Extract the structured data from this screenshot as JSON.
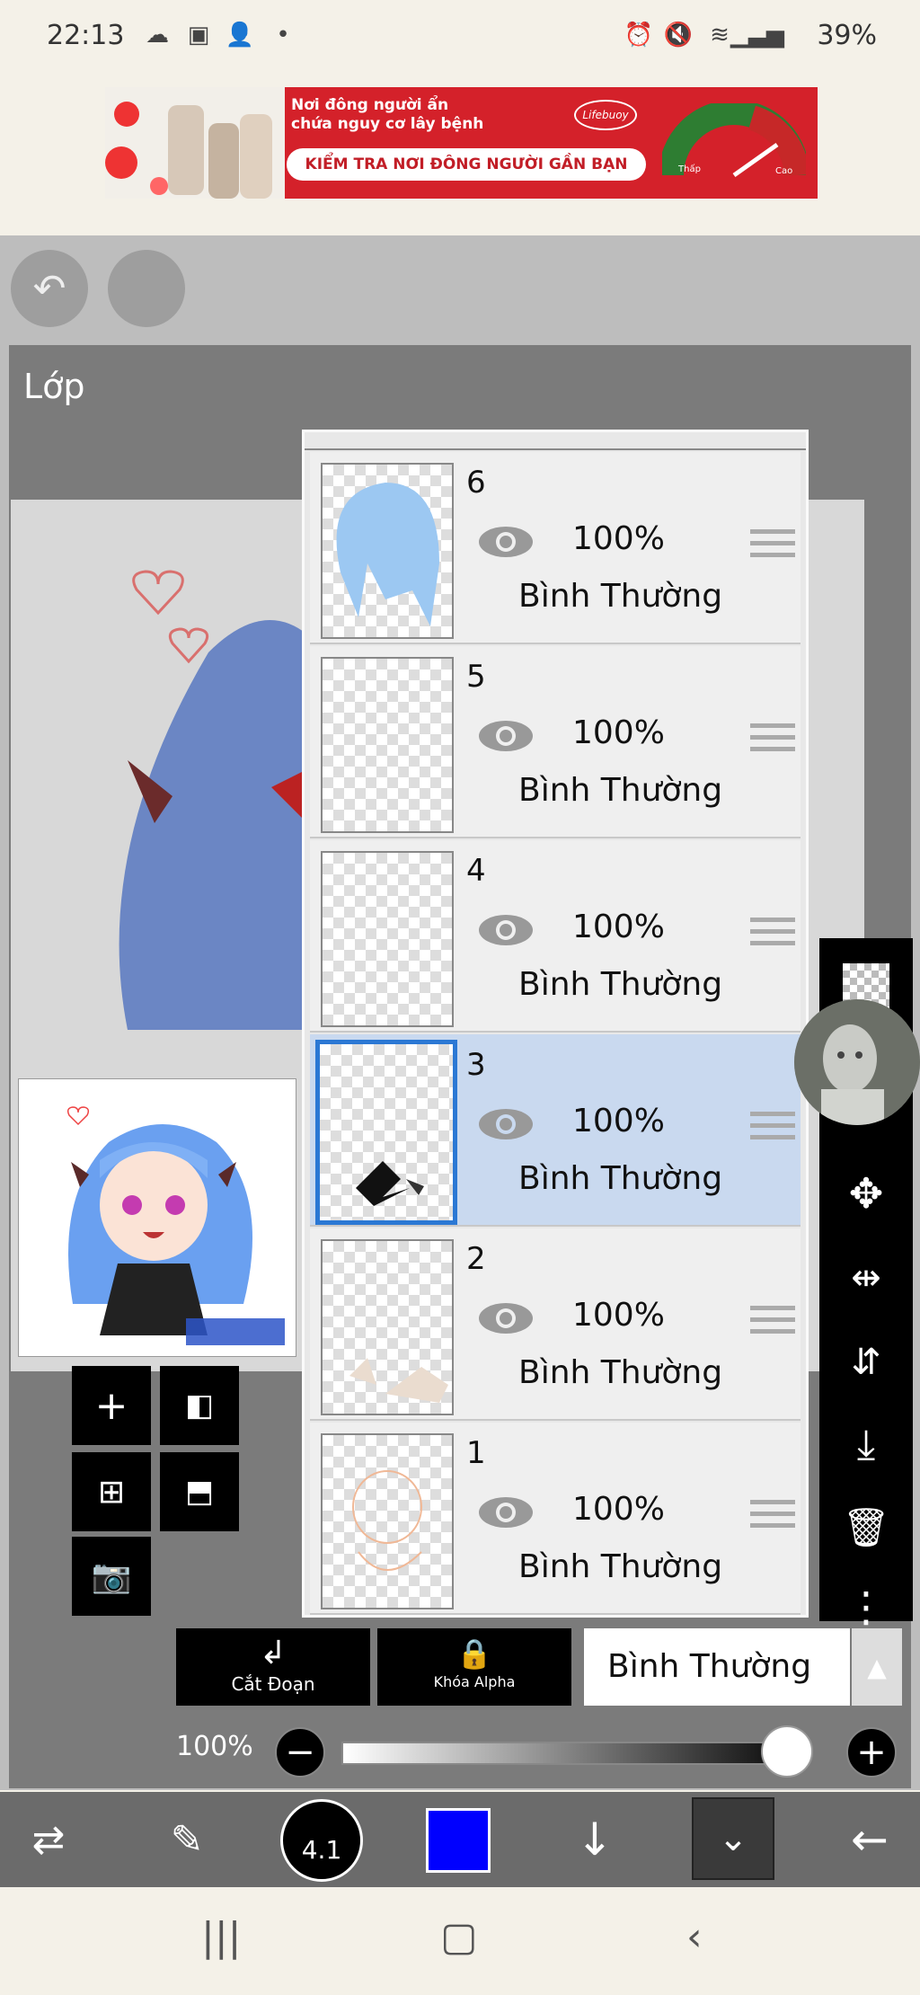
{
  "status_bar": {
    "time": "22:13",
    "battery": "39%"
  },
  "ad": {
    "headline": "Nơi đông người ẩn chứa nguy cơ lây bệnh",
    "button": "KIỂM TRA NƠI ĐÔNG NGƯỜI GẦN BẠN",
    "brand": "Lifebuoy",
    "gauge_low": "Thấp",
    "gauge_high": "Cao"
  },
  "panel": {
    "title": "Lớp"
  },
  "layers": [
    {
      "number": "6",
      "opacity": "100%",
      "blend": "Bình Thường",
      "selected": false
    },
    {
      "number": "5",
      "opacity": "100%",
      "blend": "Bình Thường",
      "selected": false
    },
    {
      "number": "4",
      "opacity": "100%",
      "blend": "Bình Thường",
      "selected": false
    },
    {
      "number": "3",
      "opacity": "100%",
      "blend": "Bình Thường",
      "selected": true
    },
    {
      "number": "2",
      "opacity": "100%",
      "blend": "Bình Thường",
      "selected": false
    },
    {
      "number": "1",
      "opacity": "100%",
      "blend": "Bình Thường",
      "selected": false
    }
  ],
  "layer_controls": {
    "clip_label": "Cắt Đoạn",
    "alpha_lock_label": "Khóa Alpha",
    "blend_mode": "Bình Thường",
    "opacity": "100%",
    "opacity_value": 1.0
  },
  "toolbar": {
    "brush_size": "4.1",
    "color": "#0000ff"
  },
  "colors": {
    "selected_layer": "#c9d9ef",
    "selected_border": "#2b78d4"
  }
}
